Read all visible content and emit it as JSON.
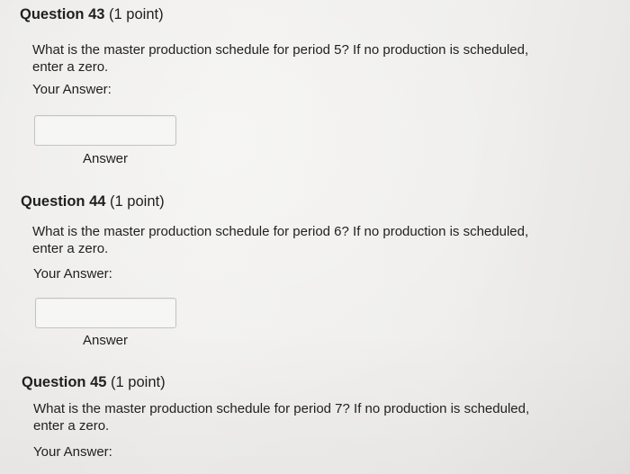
{
  "questions": [
    {
      "number": "Question 43",
      "points": "(1 point)",
      "text_line1": "What is the master production schedule for period 5? If no production is scheduled,",
      "text_line2": "enter a zero.",
      "your_answer_label": "Your Answer:",
      "answer_label": "Answer"
    },
    {
      "number": "Question 44",
      "points": "(1 point)",
      "text_line1": "What is the master production schedule for period 6? If no production is scheduled,",
      "text_line2": "enter a zero.",
      "your_answer_label": "Your Answer:",
      "answer_label": "Answer"
    },
    {
      "number": "Question 45",
      "points": "(1 point)",
      "text_line1": "What is the master production schedule for period 7? If no production is scheduled,",
      "text_line2": "enter a zero.",
      "your_answer_label": "Your Answer:"
    }
  ]
}
